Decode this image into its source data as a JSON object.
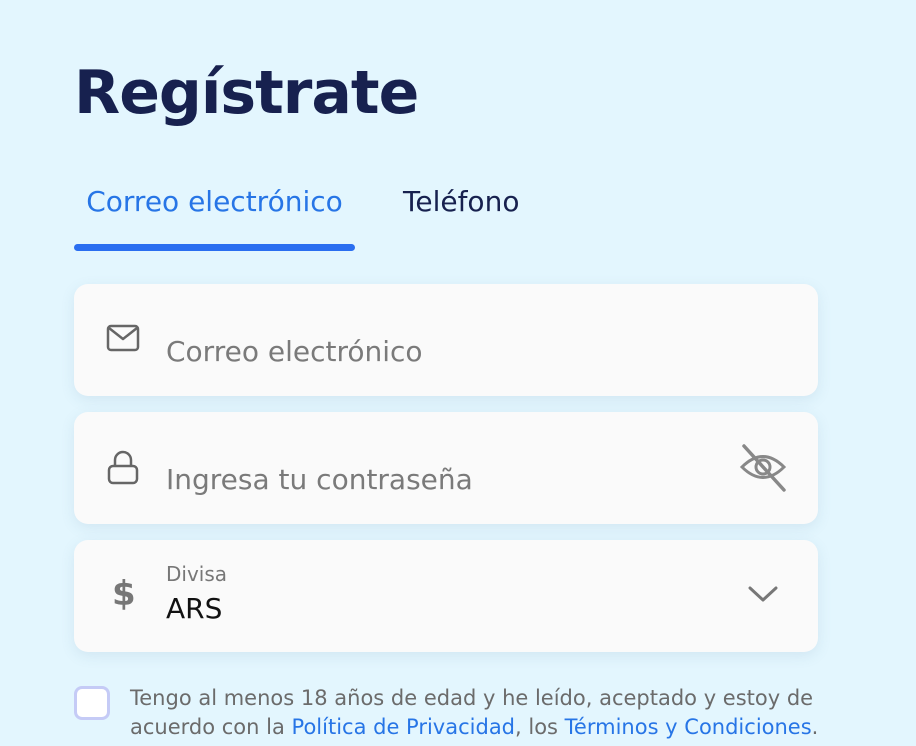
{
  "page": {
    "title": "Regístrate"
  },
  "tabs": {
    "email_label": "Correo electrónico",
    "phone_label": "Teléfono",
    "active": "email"
  },
  "email_field": {
    "placeholder": "Correo electrónico",
    "icon": "mail-icon"
  },
  "password_field": {
    "placeholder": "Ingresa tu contraseña",
    "icon": "lock-icon",
    "toggle_icon": "eye-off-icon"
  },
  "currency_field": {
    "symbol": "$",
    "label": "Divisa",
    "value": "ARS",
    "icon": "chevron-down-icon"
  },
  "consent": {
    "text_before": "Tengo al menos 18 años de edad y he leído, aceptado y estoy de acuerdo con la ",
    "privacy_link": "Política de Privacidad",
    "text_between": ", los ",
    "terms_link": "Términos y Condiciones",
    "text_after": ".",
    "checked": false
  },
  "colors": {
    "background": "#e3f6fe",
    "title": "#17214f",
    "accent": "#2775e6",
    "field_bg": "#fafafa"
  }
}
